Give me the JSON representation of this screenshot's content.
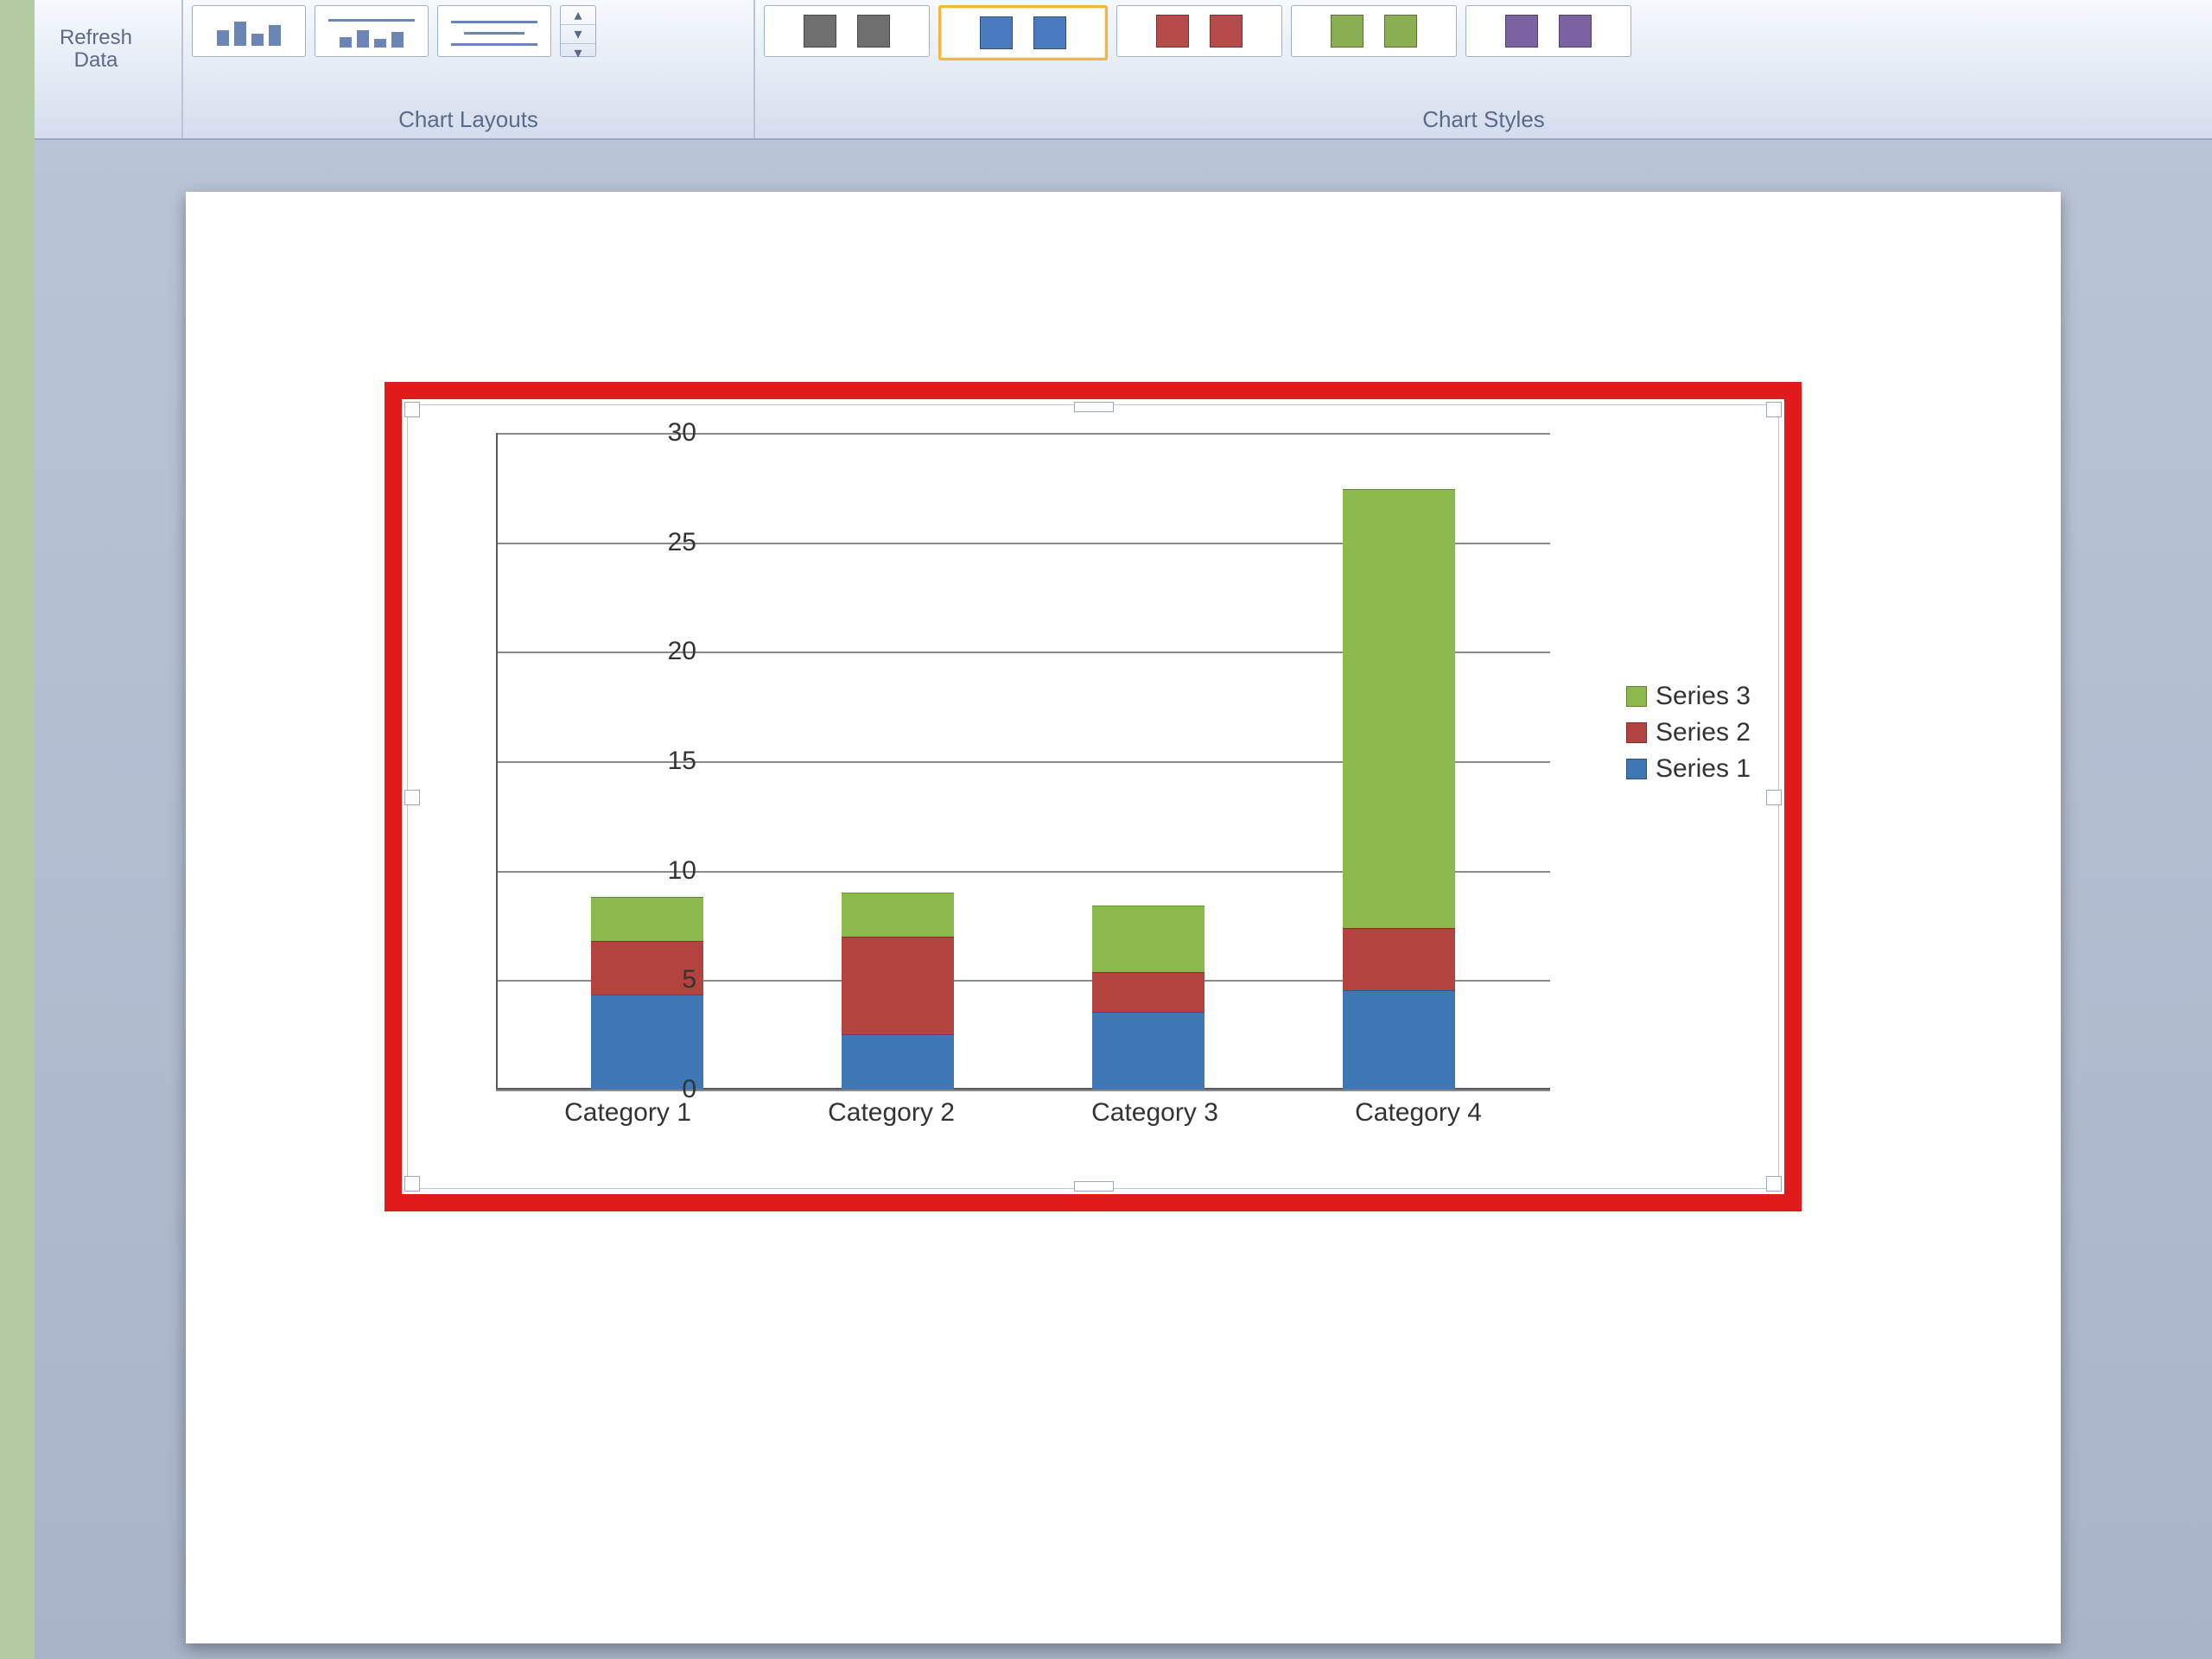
{
  "ribbon": {
    "refresh_label_line1": "Refresh",
    "refresh_label_line2": "Data",
    "section_layouts_label": "Chart Layouts",
    "section_styles_label": "Chart Styles",
    "style_swatches": [
      {
        "c": "#6f6f6f",
        "selected": false
      },
      {
        "c": "#4a7ac0",
        "selected": true
      },
      {
        "c": "#b64b4b",
        "selected": false
      },
      {
        "c": "#8aae52",
        "selected": false
      },
      {
        "c": "#7b63a3",
        "selected": false
      }
    ]
  },
  "chart_data": {
    "type": "bar",
    "stacked": true,
    "categories": [
      "Category 1",
      "Category 2",
      "Category 3",
      "Category 4"
    ],
    "series": [
      {
        "name": "Series 1",
        "color": "#3f77b5",
        "values": [
          4.3,
          2.5,
          3.5,
          4.5
        ]
      },
      {
        "name": "Series 2",
        "color": "#b4423e",
        "values": [
          2.4,
          4.4,
          1.8,
          2.8
        ]
      },
      {
        "name": "Series 3",
        "color": "#8bb94b",
        "values": [
          2.0,
          2.0,
          3.0,
          20.0
        ]
      }
    ],
    "ylim": [
      0,
      30
    ],
    "yticks": [
      0,
      5,
      10,
      15,
      20,
      25,
      30
    ],
    "legend_order": [
      "Series 3",
      "Series 2",
      "Series 1"
    ]
  }
}
